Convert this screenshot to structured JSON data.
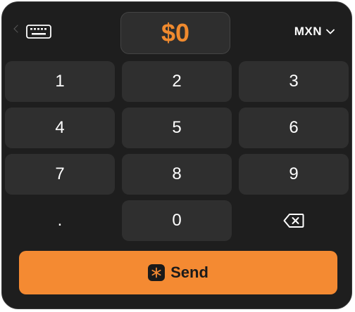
{
  "header": {
    "amount": "$0",
    "currency": "MXN",
    "keyboard_icon": "keyboard-icon",
    "dropdown_icon": "chevron-down-icon"
  },
  "keypad": {
    "keys": [
      "1",
      "2",
      "3",
      "4",
      "5",
      "6",
      "7",
      "8",
      "9",
      ".",
      "0"
    ],
    "backspace_icon": "backspace-icon"
  },
  "send": {
    "label": "Send",
    "icon": "asterisk-icon"
  },
  "colors": {
    "accent": "#f48a32",
    "amount_text": "#f08a2e",
    "background": "#1e1e1e",
    "key_background": "#2f2f2f"
  }
}
